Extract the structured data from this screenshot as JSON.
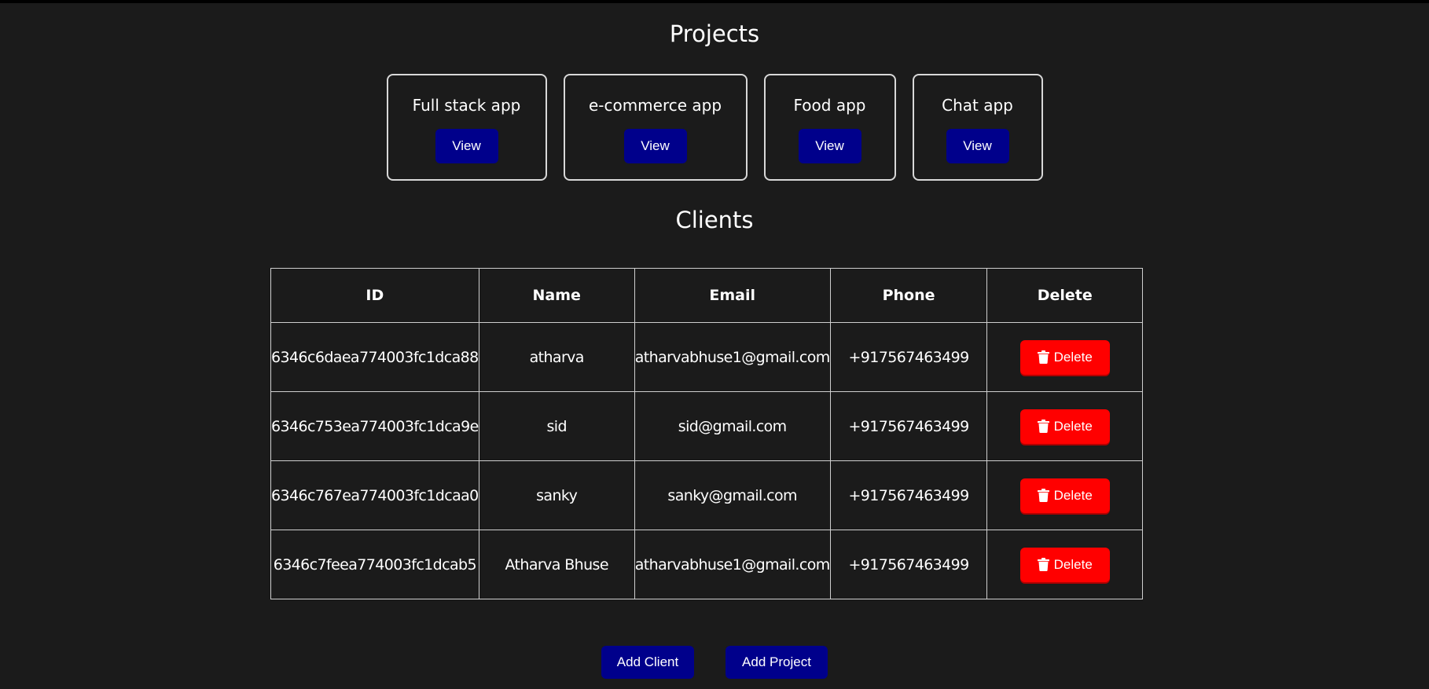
{
  "projects": {
    "title": "Projects",
    "items": [
      {
        "name": "Full stack app",
        "view_label": "View"
      },
      {
        "name": "e-commerce app",
        "view_label": "View"
      },
      {
        "name": "Food app",
        "view_label": "View"
      },
      {
        "name": "Chat app",
        "view_label": "View"
      }
    ]
  },
  "clients": {
    "title": "Clients",
    "columns": [
      "ID",
      "Name",
      "Email",
      "Phone",
      "Delete"
    ],
    "rows": [
      {
        "id": "6346c6daea774003fc1dca88",
        "name": "atharva",
        "email": "atharvabhuse1@gmail.com",
        "phone": "+917567463499",
        "delete_label": "Delete"
      },
      {
        "id": "6346c753ea774003fc1dca9e",
        "name": "sid",
        "email": "sid@gmail.com",
        "phone": "+917567463499",
        "delete_label": "Delete"
      },
      {
        "id": "6346c767ea774003fc1dcaa0",
        "name": "sanky",
        "email": "sanky@gmail.com",
        "phone": "+917567463499",
        "delete_label": "Delete"
      },
      {
        "id": "6346c7feea774003fc1dcab5",
        "name": "Atharva Bhuse",
        "email": "atharvabhuse1@gmail.com",
        "phone": "+917567463499",
        "delete_label": "Delete"
      }
    ]
  },
  "actions": {
    "add_client_label": "Add Client",
    "add_project_label": "Add Project"
  },
  "colors": {
    "background": "#1b1b1b",
    "primary_button": "#00008b",
    "danger_button": "#ff0000",
    "border": "#cfcfcf"
  },
  "icons": {
    "delete": "trash-icon"
  }
}
